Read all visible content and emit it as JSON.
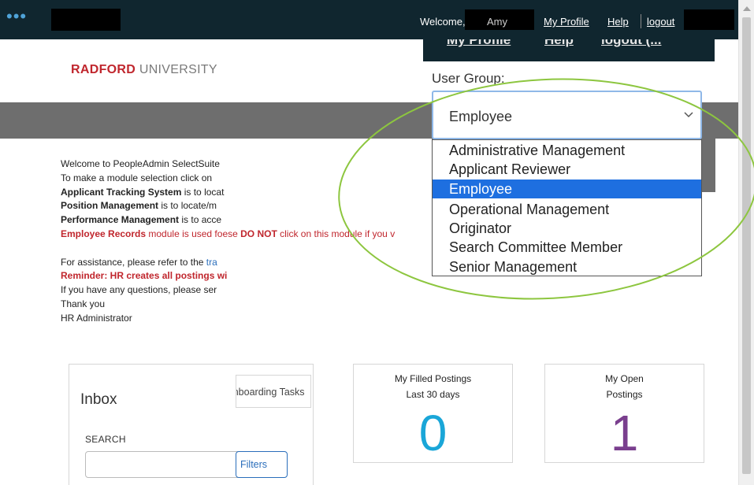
{
  "topbar": {
    "welcome_prefix": "Welcome,",
    "user_name": "Amy",
    "my_profile": "My Profile",
    "help": "Help",
    "logout": "logout"
  },
  "overlap_bar": {
    "my_profile": "My Profile",
    "help": "Help",
    "logout_fragment": "logout (..."
  },
  "logo": {
    "bold": "RADFORD",
    "rest": " UNIVERSITY"
  },
  "welcome": {
    "l1": "Welcome to PeopleAdmin SelectSuite",
    "l2": "To make a module selection click on",
    "l3_bold": "Applicant Tracking System",
    "l3_rest": " is to locat",
    "l4_bold": "Position Management",
    "l4_rest": " is to locate/m",
    "l5_bold": "Performance Management",
    "l5_rest": " is to acce",
    "l6_bold": "Employee Records",
    "l6_mid": " module is used fo",
    "l6_frag": "ese ",
    "l6_bold2": "DO NOT",
    "l6_end": " click on this module if you v",
    "l7": "For assistance, please refer to the ",
    "l7_link": "tra",
    "l8": "Reminder: HR creates all postings wi",
    "l9": "If you have any questions, please ser",
    "l10": "Thank you",
    "l11": "HR Administrator"
  },
  "user_group": {
    "label": "User Group:",
    "selected": "Employee",
    "options": [
      "Administrative Management",
      "Applicant Reviewer",
      "Employee",
      "Operational Management",
      "Originator",
      "Search Committee Member",
      "Senior Management"
    ]
  },
  "inbox": {
    "title": "Inbox",
    "tab_label": "Onboarding Tasks",
    "search_label": "SEARCH",
    "filters_label": "Filters"
  },
  "filled_postings": {
    "title": "My Filled Postings",
    "subtitle": "Last 30 days",
    "count": "0",
    "color": "#1aa6d8"
  },
  "open_postings": {
    "title": "My Open",
    "subtitle": "Postings",
    "count": "1",
    "color": "#7a3f8e"
  },
  "colors": {
    "topbar": "#10262f",
    "accent_red": "#c0262d",
    "highlight_green": "#8dc63f",
    "selected_blue": "#1e6fe0"
  }
}
